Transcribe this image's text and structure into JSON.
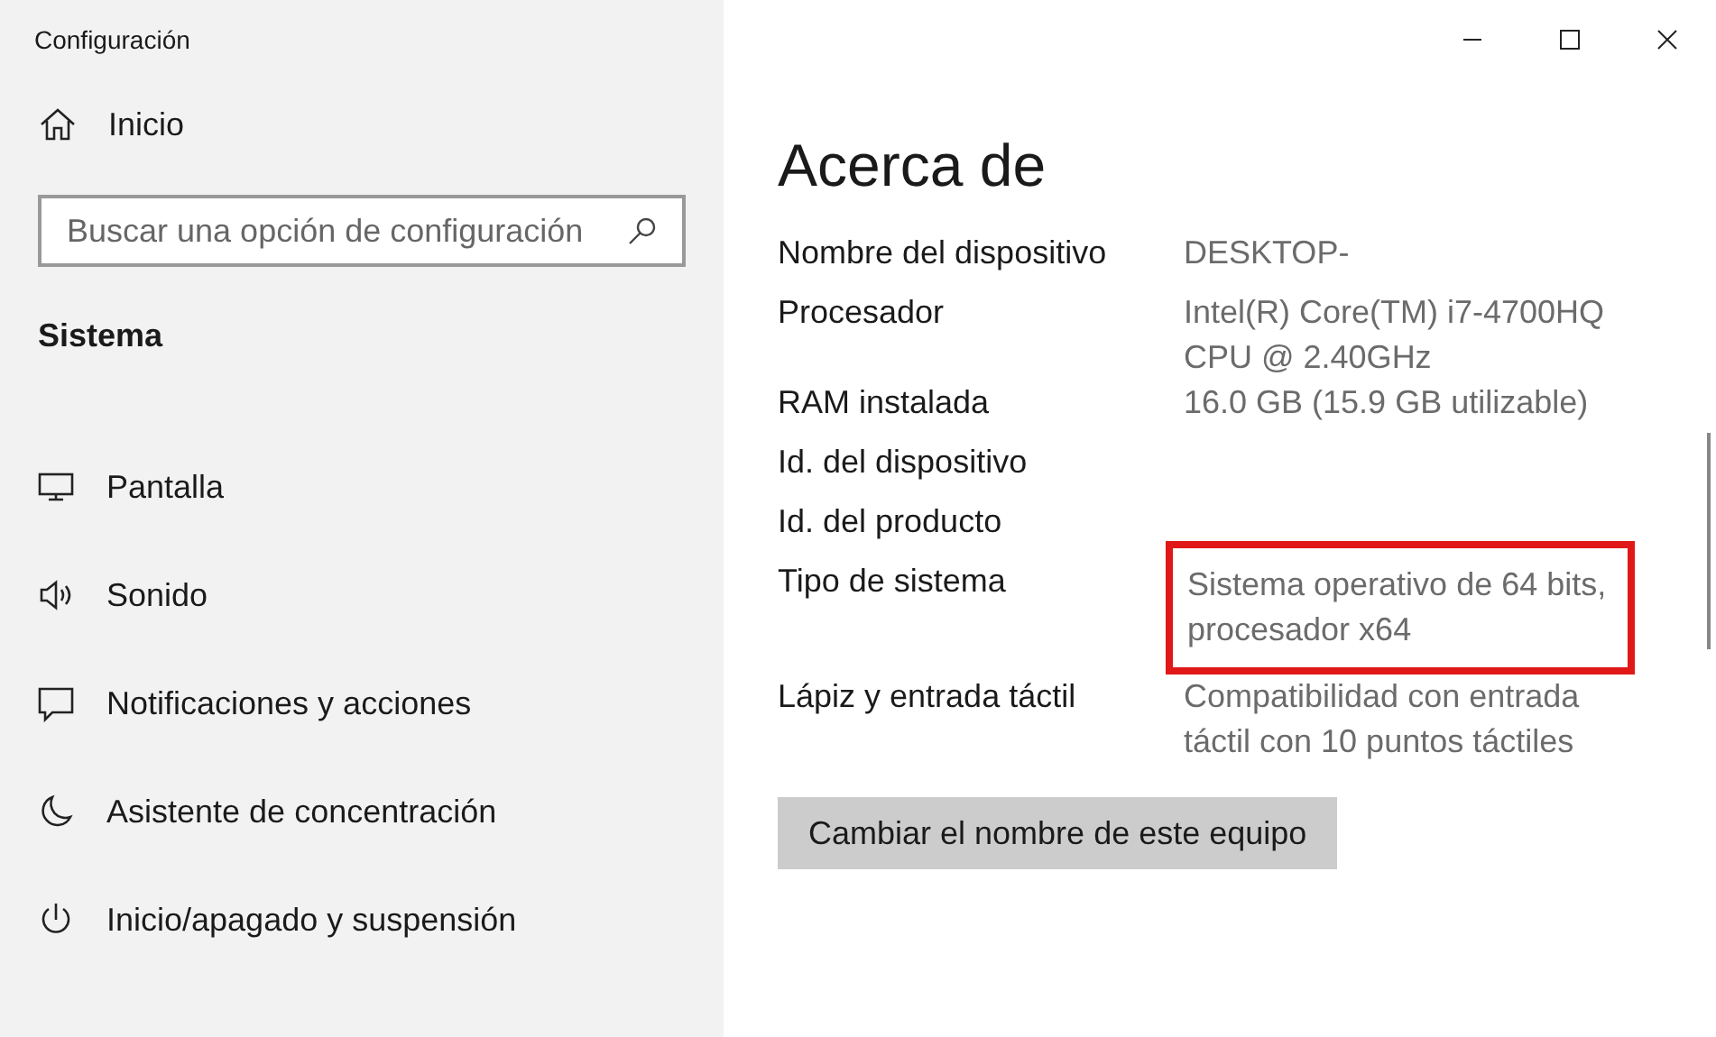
{
  "window": {
    "title": "Configuración"
  },
  "sidebar": {
    "home": "Inicio",
    "search": {
      "placeholder": "Buscar una opción de configuración"
    },
    "section": "Sistema",
    "items": [
      {
        "kind": "display",
        "label": "Pantalla"
      },
      {
        "kind": "sound",
        "label": "Sonido"
      },
      {
        "kind": "notifications",
        "label": "Notificaciones y acciones"
      },
      {
        "kind": "focus",
        "label": "Asistente de concentración"
      },
      {
        "kind": "power",
        "label": "Inicio/apagado y suspensión"
      }
    ]
  },
  "page": {
    "title": "Acerca de",
    "specs": [
      {
        "label": "Nombre del dispositivo",
        "value": "DESKTOP-"
      },
      {
        "label": "Procesador",
        "value": "Intel(R) Core(TM) i7-4700HQ CPU @ 2.40GHz"
      },
      {
        "label": "RAM instalada",
        "value": "16.0 GB (15.9 GB utilizable)"
      },
      {
        "label": "Id. del dispositivo"
      },
      {
        "label": "Id. del producto"
      },
      {
        "label": "Tipo de sistema",
        "value": "Sistema operativo de 64 bits, procesador x64",
        "highlighted": true
      },
      {
        "label": "Lápiz y entrada táctil",
        "value": "Compatibilidad con entrada táctil con 10 puntos táctiles"
      }
    ],
    "button": "Cambiar el nombre de este equipo"
  }
}
